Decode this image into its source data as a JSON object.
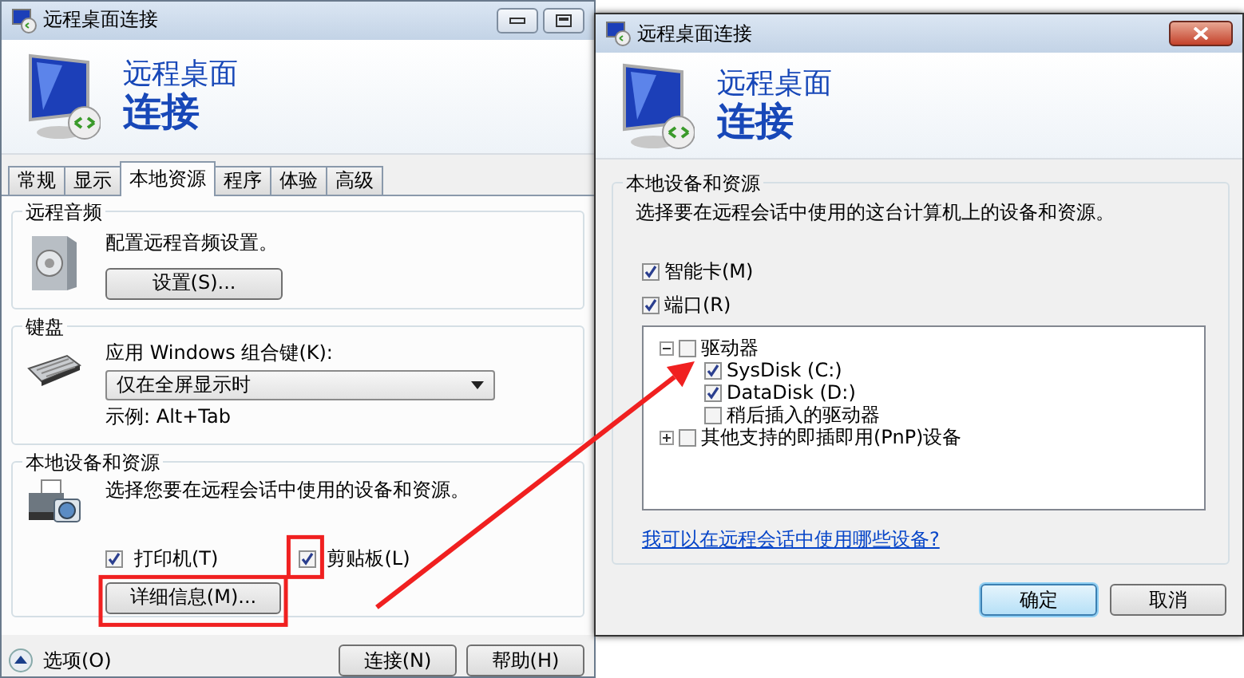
{
  "left_window": {
    "title": "远程桌面连接",
    "banner": {
      "line_1": "远程桌面",
      "line_2": "连接"
    },
    "tabs": [
      {
        "label": "常规",
        "selected": false
      },
      {
        "label": "显示",
        "selected": false
      },
      {
        "label": "本地资源",
        "selected": true
      },
      {
        "label": "程序",
        "selected": false
      },
      {
        "label": "体验",
        "selected": false
      },
      {
        "label": "高级",
        "selected": false
      }
    ],
    "audio": {
      "title": "远程音频",
      "description": "配置远程音频设置。",
      "button": "设置(S)..."
    },
    "keyboard": {
      "title": "键盘",
      "label": "应用 Windows 组合键(K):",
      "value": "仅在全屏显示时",
      "example": "示例: Alt+Tab"
    },
    "local": {
      "title": "本地设备和资源",
      "description": "选择您要在远程会话中使用的设备和资源。",
      "checks": [
        {
          "label": "打印机(T)",
          "checked": true
        },
        {
          "label": "剪贴板(L)",
          "checked": true
        }
      ],
      "button": "详细信息(M)..."
    },
    "options": "选项(O)",
    "buttons": [
      "连接(N)",
      "帮助(H)"
    ]
  },
  "right_window": {
    "title": "远程桌面连接",
    "banner": {
      "line_1": "远程桌面",
      "line_2": "连接"
    },
    "group_title": "本地设备和资源",
    "description": "选择要在远程会话中使用的这台计算机上的设备和资源。",
    "checks": [
      {
        "label": "智能卡(M)",
        "checked": true
      },
      {
        "label": "端口(R)",
        "checked": true
      }
    ],
    "tree": [
      {
        "label": "驱动器",
        "checked": false,
        "expanded": true,
        "children": [
          {
            "label": "SysDisk (C:)",
            "checked": true
          },
          {
            "label": "DataDisk (D:)",
            "checked": true
          },
          {
            "label": "稍后插入的驱动器",
            "checked": false
          }
        ]
      },
      {
        "label": "其他支持的即插即用(PnP)设备",
        "checked": false,
        "expanded": false
      }
    ],
    "link": "我可以在远程会话中使用哪些设备?",
    "buttons": [
      {
        "label": "确定",
        "kind": "default"
      },
      {
        "label": "取消",
        "kind": "normal"
      }
    ]
  }
}
